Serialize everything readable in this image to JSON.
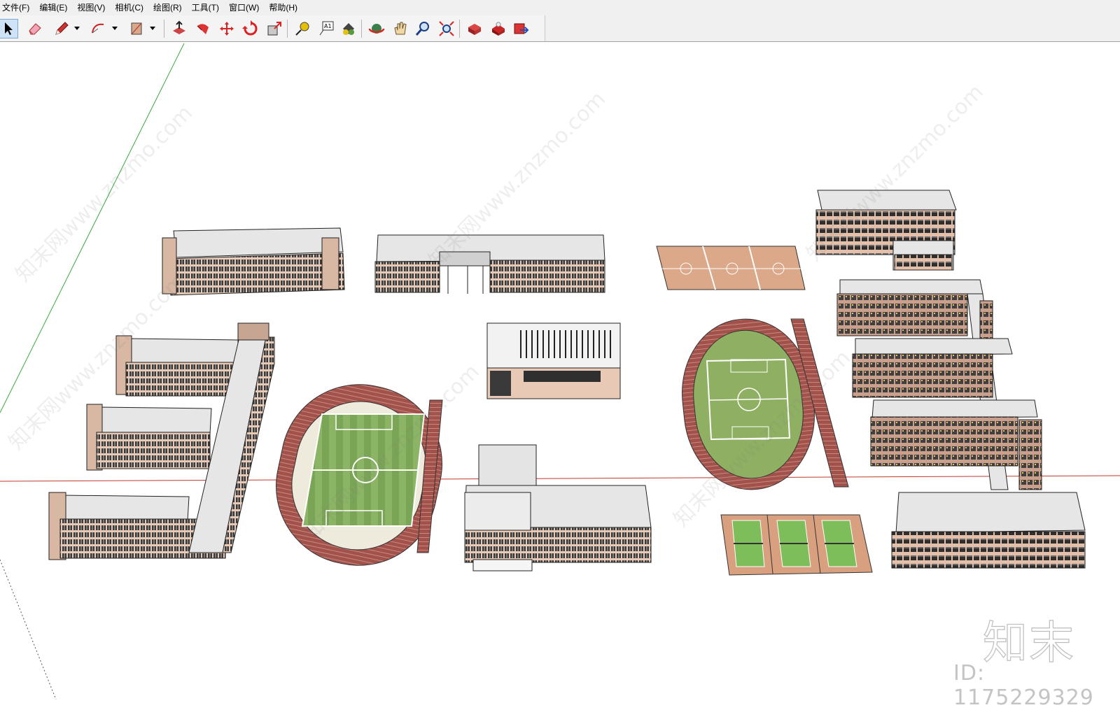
{
  "menu": [
    "文件(F)",
    "编辑(E)",
    "视图(V)",
    "相机(C)",
    "绘图(R)",
    "工具(T)",
    "窗口(W)",
    "帮助(H)"
  ],
  "toolbar": {
    "tools": [
      "select-icon",
      "eraser-icon",
      "pencil-icon",
      "arc-icon",
      "rectangle-icon",
      "push-pull-icon",
      "follow-me-icon",
      "move-icon",
      "rotate-icon",
      "scale-icon",
      "tape-measure-icon",
      "text-icon",
      "paint-bucket-icon",
      "orbit-icon",
      "pan-icon",
      "zoom-icon",
      "zoom-extents-icon",
      "component-icon",
      "warehouse-icon",
      "export-icon"
    ],
    "text_tool_label": "A1"
  },
  "watermark": {
    "brand": "知末",
    "id_text": "ID: 1175229329",
    "tile_text": "知末网www.znzmo.com"
  },
  "colors": {
    "facade": "#e8c9b5",
    "roof": "#e6e6e6",
    "court": "#dba88a",
    "grass": "#8fb062",
    "track": "#a0524a",
    "tennis": "#7dbd5a"
  }
}
